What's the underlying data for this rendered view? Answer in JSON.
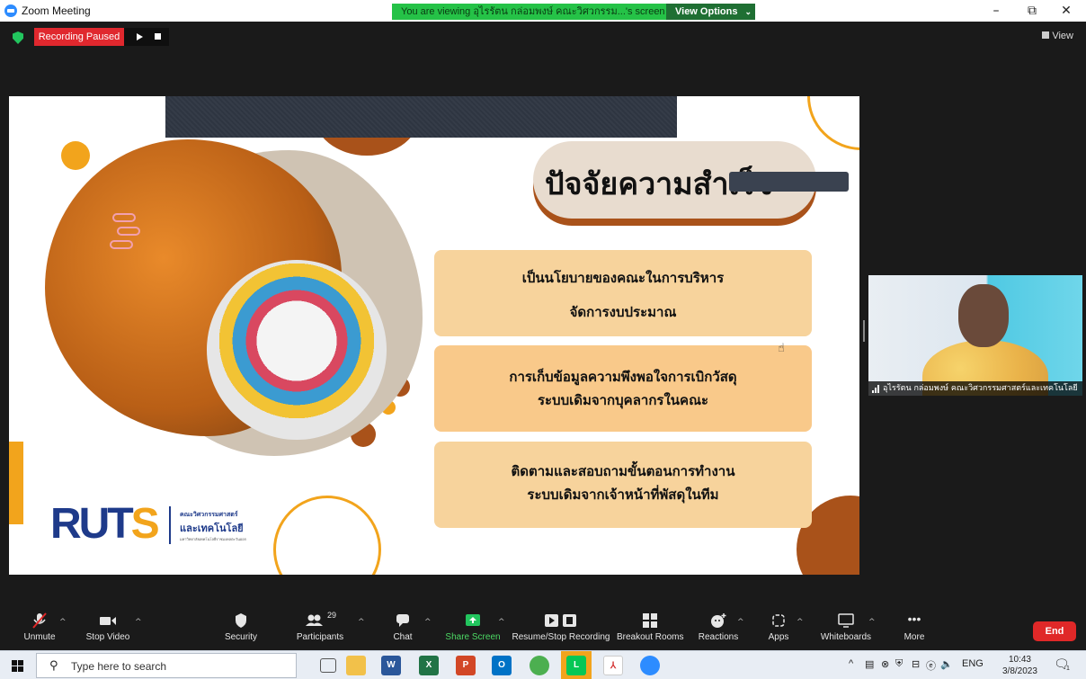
{
  "window": {
    "title": "Zoom Meeting",
    "share_banner": "You are viewing อุไรรัตน กล่อมพงษ์ คณะวิศวกรรม...'s screen",
    "view_options_label": "View Options",
    "min_glyph": "–",
    "max_glyph": "⧉",
    "close_glyph": "✕"
  },
  "meeting": {
    "recording_status": "Recording Paused",
    "view_label": "View",
    "slide": {
      "title": "ปัจจัยความสำเร็จ",
      "cards": [
        {
          "line1": "เป็นนโยบายของคณะในการบริหาร",
          "line2": "จัดการงบประมาณ"
        },
        {
          "line1": "การเก็บข้อมูลความพึงพอใจการเบิกวัสดุ",
          "line2": "ระบบเดิมจากบุคลากรในคณะ"
        },
        {
          "line1": "ติดตามและสอบถามขั้นตอนการทำงาน",
          "line2": "ระบบเดิมจากเจ้าหน้าที่พัสดุในทีม"
        }
      ],
      "logo": {
        "rut": "RUT",
        "s": "S",
        "faculty_line1": "คณะวิศวกรรมศาสตร์",
        "faculty_line2": "และเทคโนโลยี",
        "faculty_line3": "มหาวิทยาลัยเทคโนโลยีราชมงคลตะวันออก"
      },
      "colors": {
        "orange": "#f2a41c",
        "brown": "#a9521a",
        "card_light": "#f7d39c",
        "card_dark": "#f9c98a"
      }
    },
    "participant": {
      "name": "อุไรรัตน กล่อมพงษ์ คณะวิศวกรรมศาสตร์และเทคโนโลยี"
    }
  },
  "toolbar": {
    "unmute": "Unmute",
    "stop_video": "Stop Video",
    "security": "Security",
    "participants": "Participants",
    "participants_count": "29",
    "chat": "Chat",
    "share_screen": "Share Screen",
    "resume_stop_recording": "Resume/Stop Recording",
    "breakout_rooms": "Breakout Rooms",
    "reactions": "Reactions",
    "apps": "Apps",
    "whiteboards": "Whiteboards",
    "more": "More",
    "end": "End"
  },
  "taskbar": {
    "search_placeholder": "Type here to search",
    "tray_lang": "ENG",
    "time": "10:43",
    "date": "3/8/2023",
    "notification_count": "1"
  }
}
